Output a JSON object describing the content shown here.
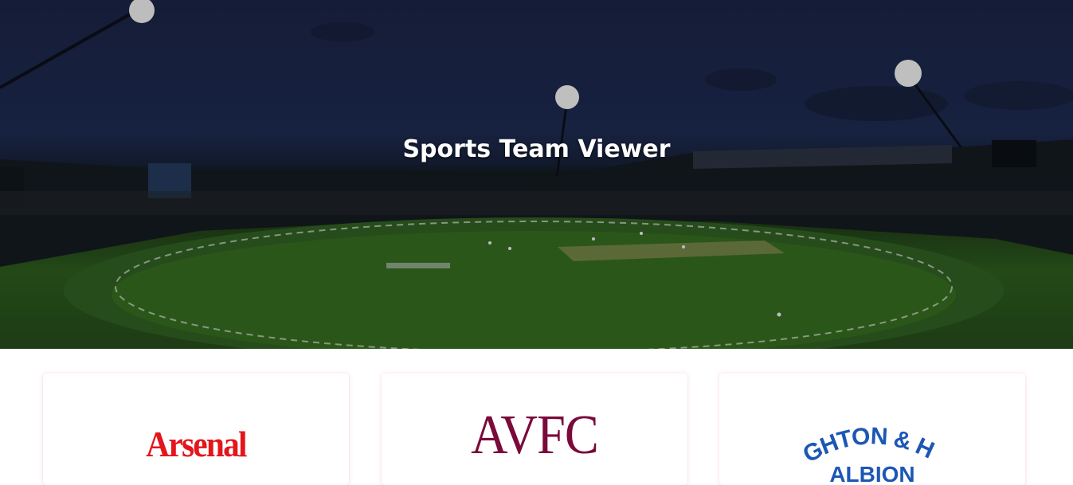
{
  "hero": {
    "title": "Sports Team Viewer"
  },
  "teams": [
    {
      "logo_text": "Arsenal",
      "color": "#e3161c"
    },
    {
      "logo_text": "AVFC",
      "color": "#7a0a3a"
    },
    {
      "logo_text_line1": "BRIGHTON & HOVE",
      "logo_text_line2": "ALBION",
      "color": "#1c57b5"
    }
  ],
  "colors": {
    "sky": "#1d2a4f",
    "pitch": "#2c5a1d",
    "card_shadow": "#dc5a5a"
  }
}
